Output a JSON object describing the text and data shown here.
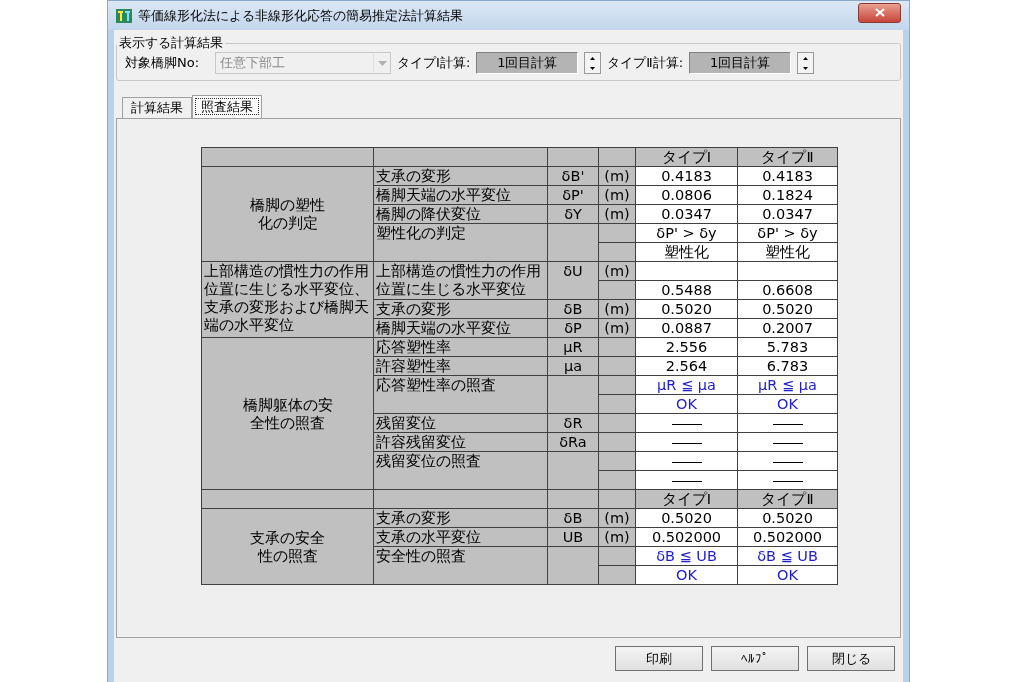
{
  "window": {
    "title": "等価線形化法による非線形化応答の簡易推定法計算結果"
  },
  "display_group": {
    "title": "表示する計算結果",
    "pier_label": "対象橋脚No:",
    "pier_value": "任意下部工",
    "pier_disabled": true,
    "calcs": [
      {
        "label": "タイプⅠ計算:",
        "value": "1回目計算"
      },
      {
        "label": "タイプⅡ計算:",
        "value": "1回目計算"
      }
    ]
  },
  "tabs": [
    {
      "label": "計算結果",
      "selected": false
    },
    {
      "label": "照査結果",
      "selected": true
    }
  ],
  "table": {
    "sections": [
      {
        "kind": "header",
        "columns": [
          "タイプⅠ",
          "タイプⅡ"
        ]
      },
      {
        "kind": "group",
        "label": "橋脚の塑性化の判定",
        "items": [
          {
            "label": "支承の変形",
            "symbol": "δB'",
            "lines": [
              {
                "unit": "(m)",
                "kind": "value",
                "values": [
                  "0.4183",
                  "0.4183"
                ]
              }
            ]
          },
          {
            "label": "橋脚天端の水平変位",
            "symbol": "δP'",
            "lines": [
              {
                "unit": "(m)",
                "kind": "value",
                "values": [
                  "0.0806",
                  "0.1824"
                ]
              }
            ]
          },
          {
            "label": "橋脚の降伏変位",
            "symbol": "δY",
            "lines": [
              {
                "unit": "(m)",
                "kind": "value",
                "values": [
                  "0.0347",
                  "0.0347"
                ]
              }
            ]
          },
          {
            "label": "塑性化の判定",
            "lines": [
              {
                "kind": "value",
                "values": [
                  "δP' > δy",
                  "δP' > δy"
                ]
              },
              {
                "kind": "value",
                "values": [
                  "塑性化",
                  "塑性化"
                ]
              }
            ]
          }
        ]
      },
      {
        "kind": "group",
        "label": "上部構造の慣性力の作用位置に生じる水平変位、支承の変形および橋脚天端の水平変位",
        "items": [
          {
            "label": "上部構造の慣性力の作用位置に生じる水平変位",
            "symbol": "δU",
            "lines": [
              {
                "unit": "(m)",
                "kind": "blank"
              },
              {
                "kind": "value",
                "values": [
                  "0.5488",
                  "0.6608"
                ]
              }
            ]
          },
          {
            "label": "支承の変形",
            "symbol": "δB",
            "lines": [
              {
                "unit": "(m)",
                "kind": "value",
                "values": [
                  "0.5020",
                  "0.5020"
                ]
              }
            ]
          },
          {
            "label": "橋脚天端の水平変位",
            "symbol": "δP",
            "lines": [
              {
                "unit": "(m)",
                "kind": "value",
                "values": [
                  "0.0887",
                  "0.2007"
                ]
              }
            ]
          }
        ]
      },
      {
        "kind": "group",
        "label": "橋脚躯体の安全性の照査",
        "items": [
          {
            "label": "応答塑性率",
            "symbol": "μR",
            "lines": [
              {
                "kind": "value",
                "values": [
                  "2.556",
                  "5.783"
                ]
              }
            ]
          },
          {
            "label": "許容塑性率",
            "symbol": "μa",
            "lines": [
              {
                "kind": "value",
                "values": [
                  "2.564",
                  "6.783"
                ]
              }
            ]
          },
          {
            "label": "応答塑性率の照査",
            "lines": [
              {
                "kind": "check",
                "values": [
                  "μR ≦ μa",
                  "μR ≦ μa"
                ]
              },
              {
                "kind": "check",
                "values": [
                  "OK",
                  "OK"
                ]
              }
            ]
          },
          {
            "label": "残留変位",
            "symbol": "δR",
            "lines": [
              {
                "kind": "dash"
              }
            ]
          },
          {
            "label": "許容残留変位",
            "symbol": "δRa",
            "lines": [
              {
                "kind": "dash"
              }
            ]
          },
          {
            "label": "残留変位の照査",
            "lines": [
              {
                "kind": "dash"
              },
              {
                "kind": "dash"
              }
            ]
          }
        ]
      },
      {
        "kind": "header",
        "columns": [
          "タイプⅠ",
          "タイプⅡ"
        ]
      },
      {
        "kind": "group",
        "label": "支承の安全性の照査",
        "items": [
          {
            "label": "支承の変形",
            "symbol": "δB",
            "lines": [
              {
                "unit": "(m)",
                "kind": "value",
                "values": [
                  "0.5020",
                  "0.5020"
                ]
              }
            ]
          },
          {
            "label": "支承の水平変位",
            "symbol": "UB",
            "lines": [
              {
                "unit": "(m)",
                "kind": "value",
                "values": [
                  "0.502000",
                  "0.502000"
                ]
              }
            ]
          },
          {
            "label": "安全性の照査",
            "lines": [
              {
                "kind": "check",
                "values": [
                  "δB ≦ UB",
                  "δB ≦ UB"
                ]
              },
              {
                "kind": "check",
                "values": [
                  "OK",
                  "OK"
                ]
              }
            ]
          }
        ]
      }
    ]
  },
  "buttons": [
    "印刷",
    "ﾍﾙﾌﾟ",
    "閉じる"
  ]
}
